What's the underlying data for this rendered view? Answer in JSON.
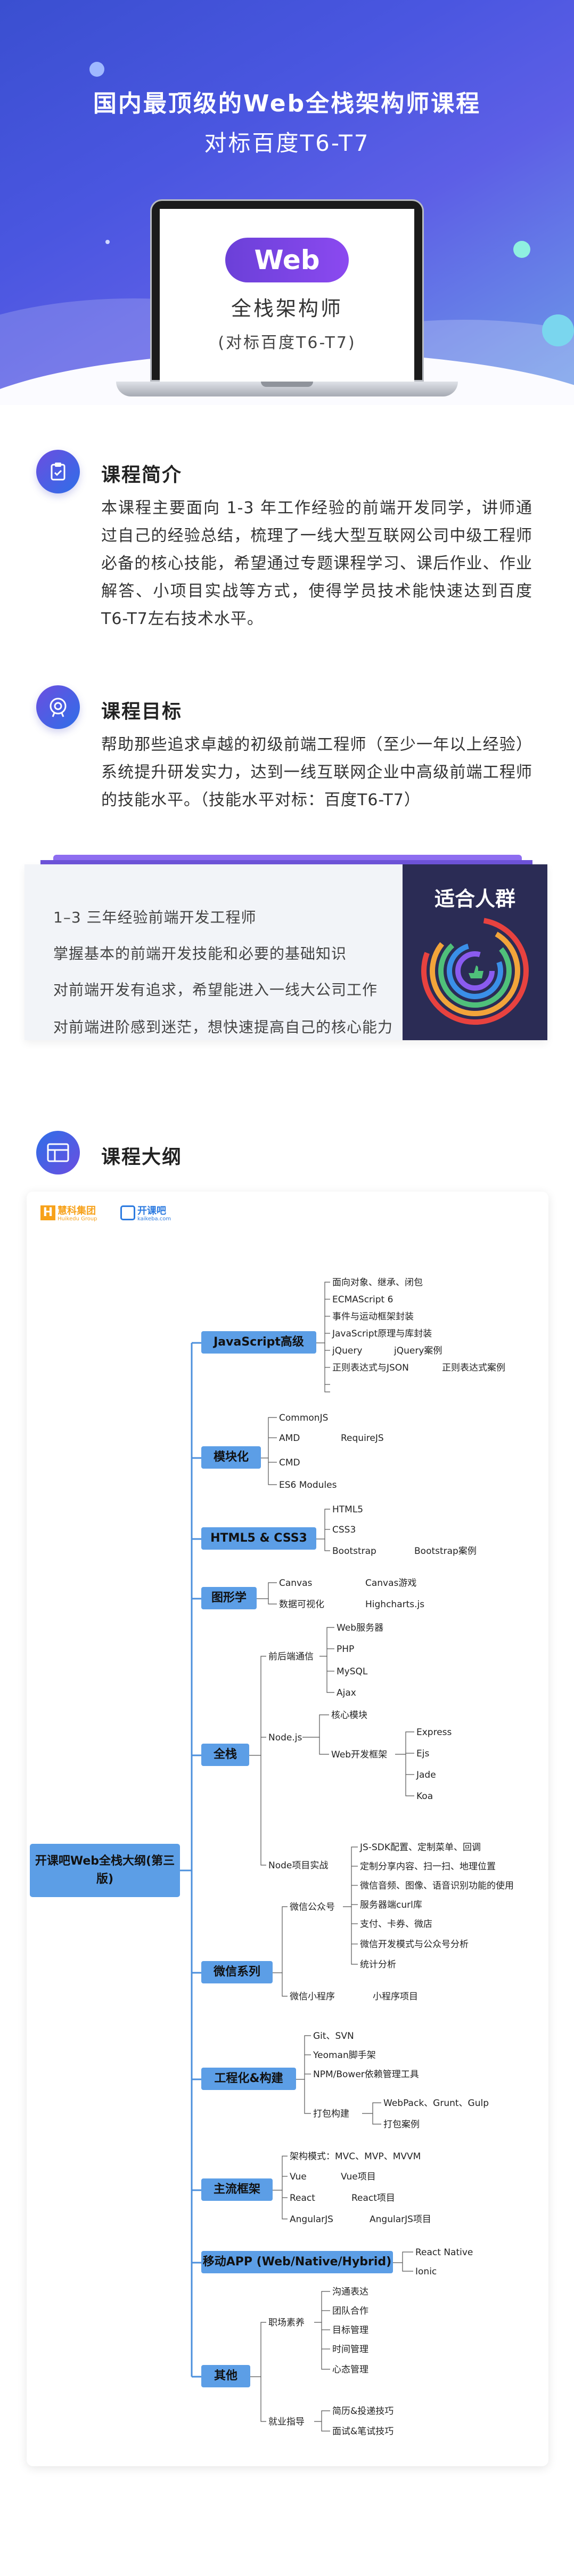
{
  "hero": {
    "title": "国内最顶级的Web全栈架构师课程",
    "subtitle": "对标百度T6-T7",
    "badge": "Web",
    "laptop_line1": "全栈架构师",
    "laptop_line2": "(对标百度T6-T7)"
  },
  "intro": {
    "title": "课程简介",
    "icon": "clipboard-icon",
    "text": "本课程主要面向 1-3 年工作经验的前端开发同学，讲师通过自己的经验总结，梳理了一线大型互联网公司中级工程师必备的核心技能，希望通过专题课程学习、课后作业、作业解答、小项目实战等方式，使得学员技术能快速达到百度T6-T7左右技术水平。"
  },
  "goal": {
    "title": "课程目标",
    "icon": "target-icon",
    "text": "帮助那些追求卓越的初级前端工程师（至少一年以上经验）系统提升研发实力，达到一线互联网企业中高级前端工程师的技能水平。（技能水平对标：百度T6-T7）"
  },
  "audience": {
    "title": "适合人群",
    "items": [
      "1–3 三年经验前端开发工程师",
      "掌握基本的前端开发技能和必要的基础知识",
      "对前端开发有追求，希望能进入一线大公司工作",
      "对前端进阶感到迷茫，想快速提高自己的核心能力"
    ],
    "ring_colors": [
      "#e8423f",
      "#f2a43a",
      "#4fc07a",
      "#3a8fe8",
      "#8a5bf0"
    ]
  },
  "outline": {
    "title": "课程大纲",
    "icon": "grid-icon",
    "logo1": "慧科集团",
    "logo1_sub": "Huikedu Group",
    "logo2": "开课吧",
    "logo2_sub": "kaikeba.com",
    "root": "开课吧Web全栈大纲(第三版)",
    "branches": [
      {
        "label": "JavaScript高级",
        "leaves": [
          "面向对象、继承、闭包",
          "ECMAScript 6",
          "事件与运动框架封装",
          "JavaScript原理与库封装",
          "jQuery",
          "jQuery案例",
          "正则表达式与JSON",
          "正则表达式案例"
        ]
      },
      {
        "label": "模块化",
        "leaves": [
          "CommonJS",
          "AMD",
          "RequireJS",
          "CMD",
          "ES6 Modules"
        ]
      },
      {
        "label": "HTML5 & CSS3",
        "leaves": [
          "HTML5",
          "CSS3",
          "Bootstrap",
          "Bootstrap案例"
        ]
      },
      {
        "label": "图形学",
        "leaves": [
          "Canvas",
          "Canvas游戏",
          "数据可视化",
          "Highcharts.js"
        ]
      },
      {
        "label": "全栈",
        "subs": [
          "前后端通信",
          "Node.js",
          "Node项目实战",
          "核心模块",
          "Web开发框架"
        ],
        "leaves": [
          "Web服务器",
          "PHP",
          "MySQL",
          "Ajax",
          "Express",
          "Ejs",
          "Jade",
          "Koa"
        ]
      },
      {
        "label": "微信系列",
        "subs": [
          "微信公众号",
          "微信小程序"
        ],
        "leaves": [
          "JS-SDK配置、定制菜单、回调",
          "定制分享内容、扫一扫、地理位置",
          "微信音频、图像、语音识别功能的使用",
          "服务器端curl库",
          "支付、卡券、微店",
          "微信开发模式与公众号分析",
          "统计分析",
          "小程序项目"
        ]
      },
      {
        "label": "工程化&构建",
        "subs": [
          "打包构建"
        ],
        "leaves": [
          "Git、SVN",
          "Yeoman脚手架",
          "NPM/Bower依赖管理工具",
          "WebPack、Grunt、Gulp",
          "打包案例"
        ]
      },
      {
        "label": "主流框架",
        "leaves": [
          "架构模式：MVC、MVP、MVVM",
          "Vue",
          "Vue项目",
          "React",
          "React项目",
          "AngularJS",
          "AngularJS项目"
        ]
      },
      {
        "label": "移动APP (Web/Native/Hybrid)",
        "leaves": [
          "React Native",
          "Ionic"
        ]
      },
      {
        "label": "其他",
        "subs": [
          "职场素养",
          "就业指导"
        ],
        "leaves": [
          "沟通表达",
          "团队合作",
          "目标管理",
          "时间管理",
          "心态管理",
          "简历&投递技巧",
          "面试&笔试技巧"
        ]
      }
    ]
  }
}
